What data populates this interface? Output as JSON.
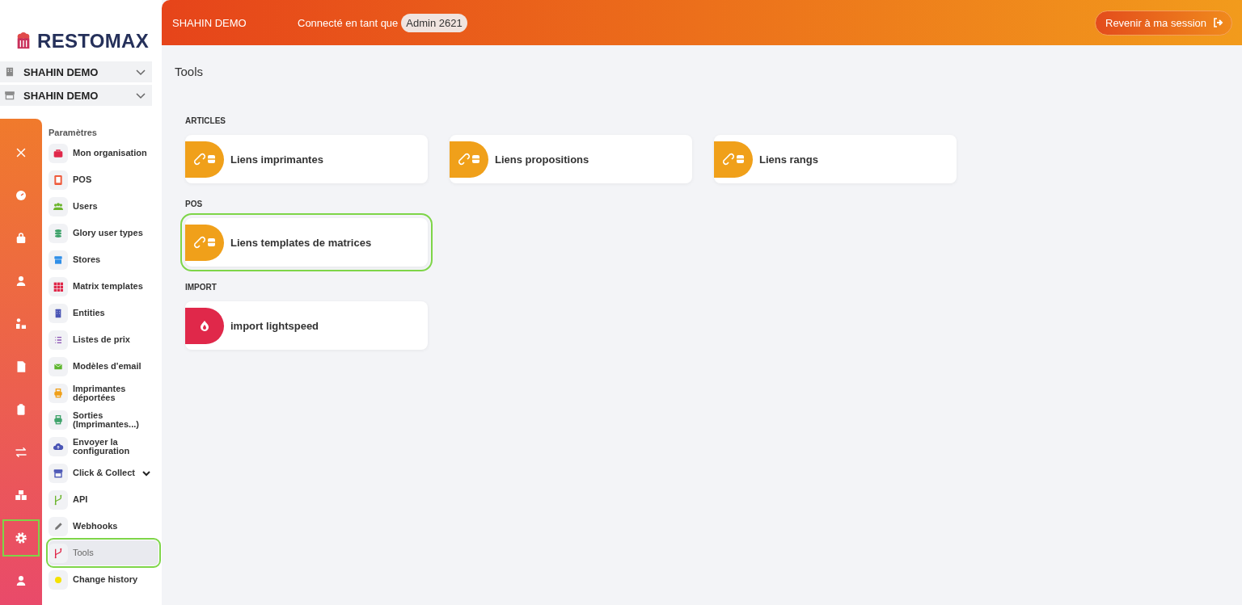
{
  "logo": {
    "text": "RESTOMAX"
  },
  "selectors": [
    {
      "label": "SHAHIN DEMO"
    },
    {
      "label": "SHAHIN DEMO"
    }
  ],
  "rail": [
    {
      "highlighted": false
    },
    {
      "highlighted": false
    },
    {
      "highlighted": false
    },
    {
      "highlighted": false
    },
    {
      "highlighted": false
    },
    {
      "highlighted": false
    },
    {
      "highlighted": false
    },
    {
      "highlighted": false
    },
    {
      "highlighted": false
    },
    {
      "highlighted": true
    },
    {
      "highlighted": false
    }
  ],
  "menu": {
    "title": "Paramètres",
    "items": [
      {
        "label": "Mon organisation",
        "kind": "link",
        "color": "#e0284a",
        "selected": false,
        "highlighted": false
      },
      {
        "label": "POS",
        "kind": "link",
        "color": "#ef5b3c",
        "selected": false,
        "highlighted": false
      },
      {
        "label": "Users",
        "kind": "link",
        "color": "#6cb52d",
        "selected": false,
        "highlighted": false
      },
      {
        "label": "Glory user types",
        "kind": "link",
        "color": "#3fa36b",
        "selected": false,
        "highlighted": false
      },
      {
        "label": "Stores",
        "kind": "link",
        "color": "#2f8fe8",
        "selected": false,
        "highlighted": false
      },
      {
        "label": "Matrix templates",
        "kind": "link",
        "color": "#e0284a",
        "selected": false,
        "highlighted": false
      },
      {
        "label": "Entities",
        "kind": "link",
        "color": "#4a55b5",
        "selected": false,
        "highlighted": false
      },
      {
        "label": "Listes de prix",
        "kind": "link",
        "color": "#8a4fb5",
        "selected": false,
        "highlighted": false
      },
      {
        "label": "Modèles d'email",
        "kind": "link",
        "color": "#5db52d",
        "selected": false,
        "highlighted": false
      },
      {
        "label": "Imprimantes déportées",
        "kind": "link",
        "color": "#f0a01a",
        "selected": false,
        "highlighted": false
      },
      {
        "label": "Sorties (Imprimantes...)",
        "kind": "link",
        "color": "#3fa36b",
        "selected": false,
        "highlighted": false
      },
      {
        "label": "Envoyer la configuration",
        "kind": "link",
        "color": "#4a55b5",
        "selected": false,
        "highlighted": false
      },
      {
        "label": "Click & Collect",
        "kind": "group",
        "color": "#4a55b5",
        "selected": false,
        "highlighted": false
      },
      {
        "label": "API",
        "kind": "link",
        "color": "#6cb52d",
        "selected": false,
        "highlighted": false
      },
      {
        "label": "Webhooks",
        "kind": "link",
        "color": "#777777",
        "selected": false,
        "highlighted": false
      },
      {
        "label": "Tools",
        "kind": "link",
        "color": "#e0284a",
        "selected": true,
        "highlighted": true
      },
      {
        "label": "Change history",
        "kind": "link",
        "color": "#f5e200",
        "selected": false,
        "highlighted": false
      }
    ]
  },
  "header": {
    "org": "SHAHIN DEMO",
    "connected_as": "Connecté en tant que",
    "user_badge": "Admin 2621",
    "return_button": "Revenir à ma session"
  },
  "page_title": "Tools",
  "sections": [
    {
      "title": "ARTICLES",
      "cards": [
        {
          "label": "Liens imprimantes",
          "kind": "links",
          "color": "#f0a01a",
          "highlighted": false
        },
        {
          "label": "Liens propositions",
          "kind": "links",
          "color": "#f0a01a",
          "highlighted": false
        },
        {
          "label": "Liens rangs",
          "kind": "links",
          "color": "#f0a01a",
          "highlighted": false
        }
      ]
    },
    {
      "title": "POS",
      "cards": [
        {
          "label": "Liens templates de matrices",
          "kind": "links",
          "color": "#f0a01a",
          "highlighted": true
        }
      ]
    },
    {
      "title": "IMPORT",
      "cards": [
        {
          "label": "import lightspeed",
          "kind": "import",
          "color": "#e0284a",
          "highlighted": false
        }
      ]
    }
  ]
}
